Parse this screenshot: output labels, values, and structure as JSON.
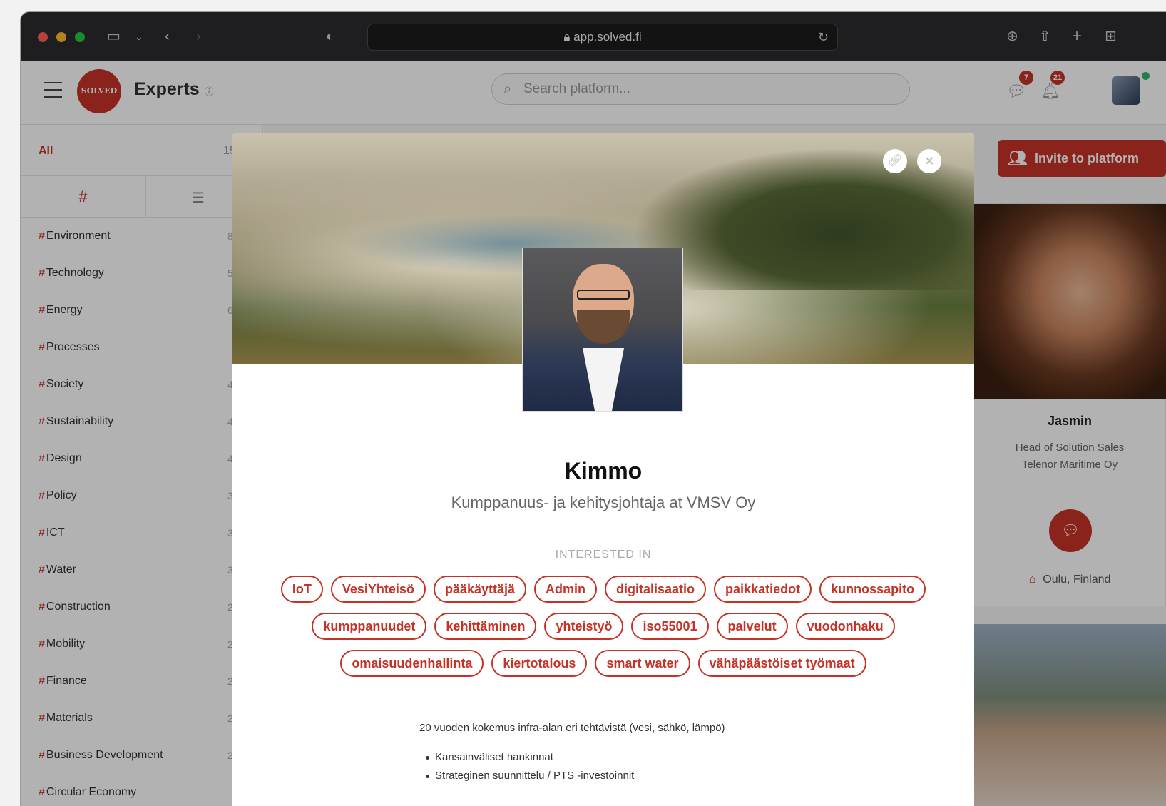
{
  "browser": {
    "url": "app.solved.fi"
  },
  "app": {
    "logo_text": "SOLVED",
    "brand": "Experts",
    "search_placeholder": "Search platform...",
    "messages_count": "7",
    "notifications_count": "21"
  },
  "sidebar": {
    "all_label": "All",
    "all_count": "15",
    "topics": [
      {
        "label": "Environment",
        "count": "8"
      },
      {
        "label": "Technology",
        "count": "5"
      },
      {
        "label": "Energy",
        "count": "6"
      },
      {
        "label": "Processes",
        "count": ""
      },
      {
        "label": "Society",
        "count": "4"
      },
      {
        "label": "Sustainability",
        "count": "4"
      },
      {
        "label": "Design",
        "count": "4"
      },
      {
        "label": "Policy",
        "count": "3"
      },
      {
        "label": "ICT",
        "count": "3"
      },
      {
        "label": "Water",
        "count": "3"
      },
      {
        "label": "Construction",
        "count": "2"
      },
      {
        "label": "Mobility",
        "count": "2"
      },
      {
        "label": "Finance",
        "count": "2"
      },
      {
        "label": "Materials",
        "count": "2"
      },
      {
        "label": "Business Development",
        "count": "2"
      },
      {
        "label": "Circular Economy",
        "count": ""
      }
    ]
  },
  "main": {
    "invite_label": "Invite to platform",
    "card": {
      "name": "Jasmin",
      "role": "Head of Solution Sales",
      "company": "Telenor Maritime Oy",
      "location": "Oulu, Finland"
    }
  },
  "modal": {
    "name": "Kimmo",
    "title": "Kumppanuus- ja kehitysjohtaja at VMSV Oy",
    "interested_label": "INTERESTED IN",
    "tags": [
      "IoT",
      "VesiYhteisö",
      "pääkäyttäjä",
      "Admin",
      "digitalisaatio",
      "paikkatiedot",
      "kunnossapito",
      "kumppanuudet",
      "kehittäminen",
      "yhteistyö",
      "iso55001",
      "palvelut",
      "vuodonhaku",
      "omaisuudenhallinta",
      "kiertotalous",
      "smart water",
      "vähäpäästöiset työmaat"
    ],
    "description": "20 vuoden kokemus infra-alan eri tehtävistä (vesi, sähkö, lämpö)",
    "bullets": [
      "Kansainväliset hankinnat",
      "Strateginen suunnittelu / PTS -investoinnit"
    ]
  }
}
